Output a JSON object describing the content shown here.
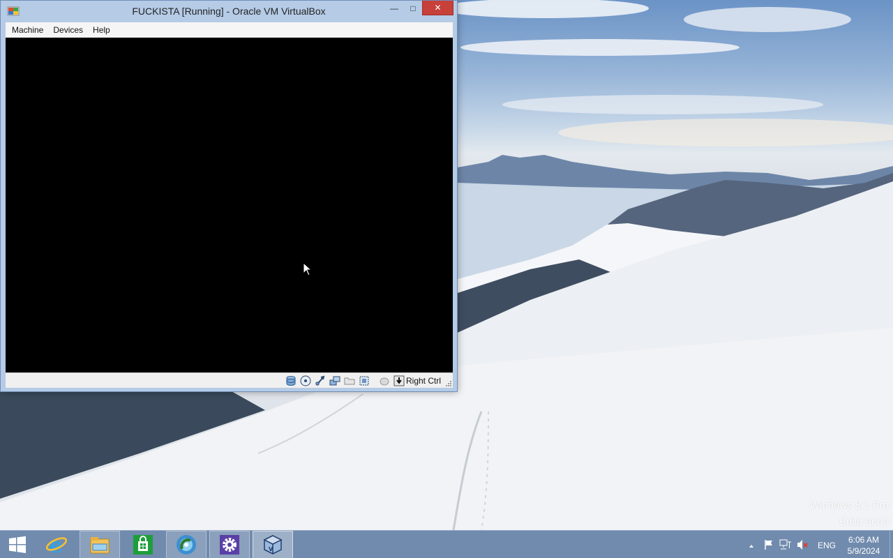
{
  "window": {
    "title": "FUCKISTA [Running] - Oracle VM VirtualBox",
    "controls": {
      "minimize": "—",
      "maximize": "□",
      "close": "✕"
    }
  },
  "menubar": {
    "items": [
      {
        "label": "Machine"
      },
      {
        "label": "Devices"
      },
      {
        "label": "Help"
      }
    ]
  },
  "statusbar": {
    "icons": [
      "hard-disk-icon",
      "optical-drive-icon",
      "usb-icon",
      "network-icon",
      "shared-folders-icon",
      "video-capture-icon",
      "mouse-integration-icon",
      "host-key-icon"
    ],
    "host_key_label": "Right Ctrl"
  },
  "desktop": {
    "watermark_edition": "Windows 8.1 Pro",
    "watermark_build": "Build 9600"
  },
  "taskbar": {
    "apps": [
      {
        "name": "internet-explorer-icon",
        "state": "pinned"
      },
      {
        "name": "file-explorer-icon",
        "state": "running"
      },
      {
        "name": "store-icon",
        "state": "pinned"
      },
      {
        "name": "media-player-icon",
        "state": "running"
      },
      {
        "name": "settings-gear-icon",
        "state": "running"
      },
      {
        "name": "virtualbox-icon",
        "state": "active"
      }
    ],
    "tray": {
      "icons": [
        "show-hidden-icons-chevron-icon",
        "action-center-flag-icon",
        "network-icon",
        "volume-muted-icon"
      ],
      "language": "ENG",
      "time": "6:06 AM",
      "date": "5/9/2024"
    }
  },
  "colors": {
    "close_button": "#c7403a",
    "vm_screen": "#000000",
    "window_frame": "#b5cbe6",
    "store_green": "#1d9e3a",
    "settings_purple": "#5a3fa6"
  }
}
